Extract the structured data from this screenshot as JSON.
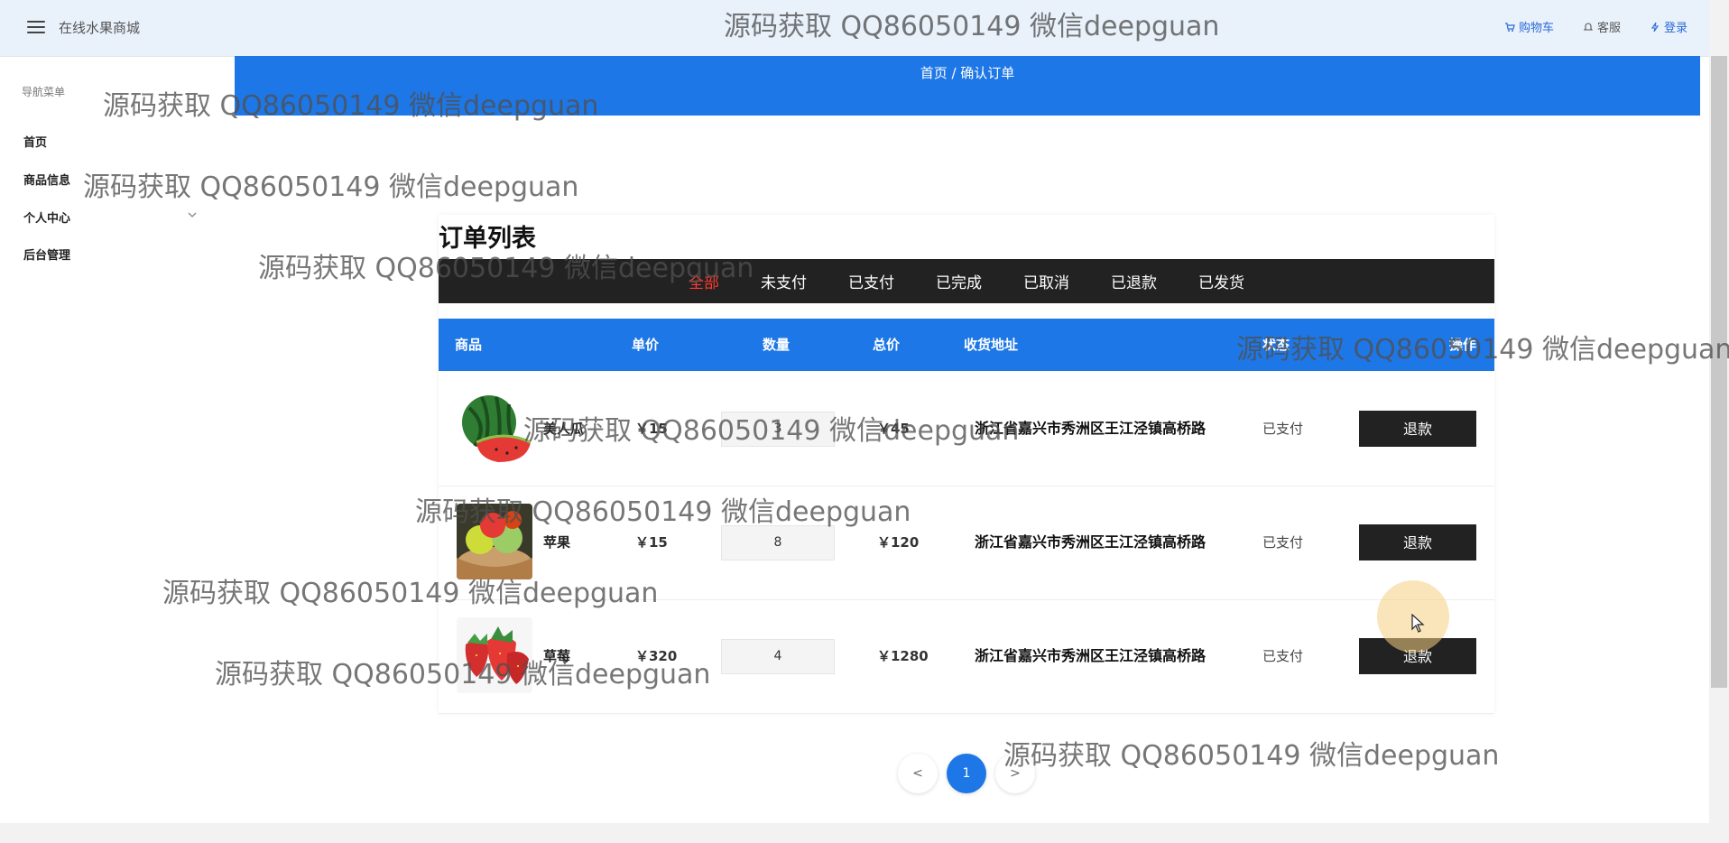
{
  "header": {
    "app_title": "在线水果商城",
    "links": [
      "购物车",
      "客服",
      "登录"
    ]
  },
  "sidebar": {
    "header": "导航菜单",
    "items": [
      "首页",
      "商品信息",
      "个人中心",
      "后台管理"
    ]
  },
  "breadcrumb": "首页 / 确认订单",
  "orders": {
    "title": "订单列表",
    "tabs": [
      "全部",
      "未支付",
      "已支付",
      "已完成",
      "已取消",
      "已退款",
      "已发货"
    ],
    "active_tab": "全部",
    "columns": [
      "商品",
      "单价",
      "数量",
      "总价",
      "收货地址",
      "状态",
      "操作"
    ],
    "rows": [
      {
        "name": "美人瓜",
        "price": "￥15",
        "qty": "3",
        "total": "￥45",
        "address": "浙江省嘉兴市秀洲区王江泾镇高桥路",
        "status": "已支付",
        "action": "退款",
        "image": "watermelon"
      },
      {
        "name": "苹果",
        "price": "￥15",
        "qty": "8",
        "total": "￥120",
        "address": "浙江省嘉兴市秀洲区王江泾镇高桥路",
        "status": "已支付",
        "action": "退款",
        "image": "apples"
      },
      {
        "name": "草莓",
        "price": "￥320",
        "qty": "4",
        "total": "￥1280",
        "address": "浙江省嘉兴市秀洲区王江泾镇高桥路",
        "status": "已支付",
        "action": "退款",
        "image": "strawberries"
      }
    ]
  },
  "pagination": {
    "prev": "<",
    "current": "1",
    "next": ">"
  },
  "watermark": "源码获取 QQ86050149 微信deepguan",
  "colors": {
    "accent": "#1e77e6",
    "dark": "#222222",
    "active_tab": "#ff3b30"
  }
}
